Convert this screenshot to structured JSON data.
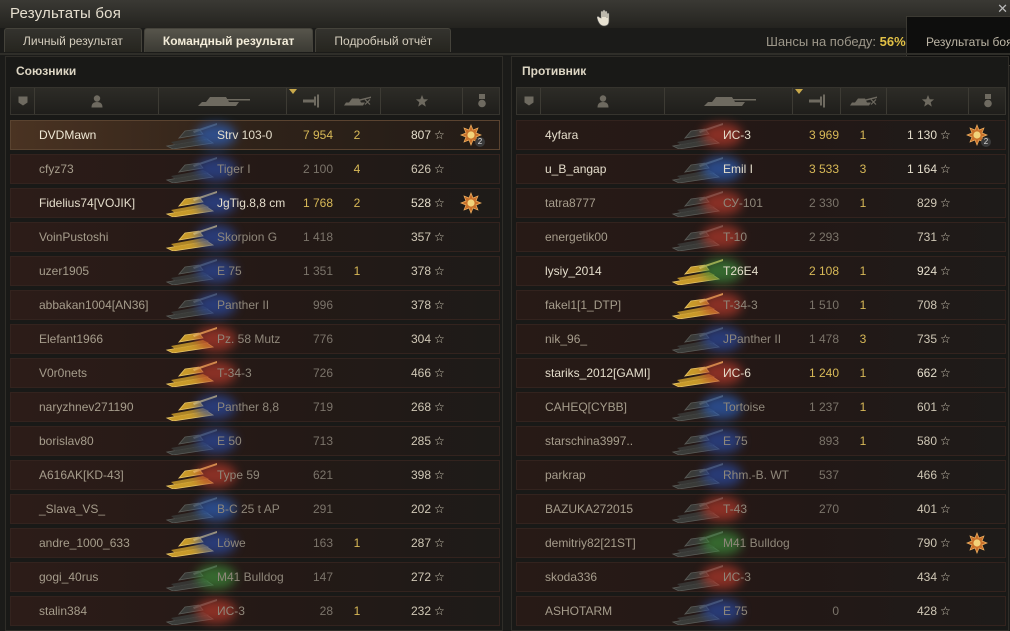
{
  "window": {
    "title": "Результаты боя"
  },
  "tabs": [
    {
      "label": "Личный результат",
      "active": false
    },
    {
      "label": "Командный результат",
      "active": true
    },
    {
      "label": "Подробный отчёт",
      "active": false
    }
  ],
  "chances": {
    "label": "Шансы на победу:",
    "value": "56%"
  },
  "tooltip": {
    "text": "Результаты боя"
  },
  "colors": {
    "accent": "#d8b957",
    "highlight_name": "#f0e9d6",
    "background": "#1b1b19"
  },
  "allies": {
    "title": "Союзники",
    "players": [
      {
        "name": "DVDMawn",
        "tank": "Strv 103-0",
        "tank_tone": "dark",
        "nation": "#2d5fb8",
        "damage": "7 954",
        "kills": "2",
        "xp": "807",
        "bright": true,
        "me": true,
        "medal": {
          "kind": "orange",
          "count": "2"
        }
      },
      {
        "name": "cfyz73",
        "tank": "Tiger I",
        "tank_tone": "dark",
        "nation": "#2b4aa0",
        "damage": "2 100",
        "kills": "4",
        "xp": "626",
        "bright": false,
        "me": false,
        "medal": null
      },
      {
        "name": "Fidelius74[VOJIK]",
        "tank": "JgTig.8,8 cm",
        "tank_tone": "gold",
        "nation": "#2b4aa0",
        "damage": "1 768",
        "kills": "2",
        "xp": "528",
        "bright": true,
        "me": false,
        "medal": {
          "kind": "orange",
          "count": ""
        }
      },
      {
        "name": "VoinPustoshi",
        "tank": "Skorpion G",
        "tank_tone": "gold",
        "nation": "#2b4aa0",
        "damage": "1 418",
        "kills": "",
        "xp": "357",
        "bright": false,
        "me": false,
        "medal": null
      },
      {
        "name": "uzer1905",
        "tank": "E 75",
        "tank_tone": "dark",
        "nation": "#2b4aa0",
        "damage": "1 351",
        "kills": "1",
        "xp": "378",
        "bright": false,
        "me": false,
        "medal": null
      },
      {
        "name": "abbakan1004[AN36]",
        "tank": "Panther II",
        "tank_tone": "dark",
        "nation": "#2b4aa0",
        "damage": "996",
        "kills": "",
        "xp": "378",
        "bright": false,
        "me": false,
        "medal": null
      },
      {
        "name": "Elefant1966",
        "tank": "Pz. 58 Mutz",
        "tank_tone": "gold",
        "nation": "#b43a2c",
        "damage": "776",
        "kills": "",
        "xp": "304",
        "bright": false,
        "me": false,
        "medal": null
      },
      {
        "name": "V0r0nets",
        "tank": "T-34-3",
        "tank_tone": "gold",
        "nation": "#b43a2c",
        "damage": "726",
        "kills": "",
        "xp": "466",
        "bright": false,
        "me": false,
        "medal": null
      },
      {
        "name": "naryzhnev271190",
        "tank": "Panther 8,8",
        "tank_tone": "gold",
        "nation": "#2b4aa0",
        "damage": "719",
        "kills": "",
        "xp": "268",
        "bright": false,
        "me": false,
        "medal": null
      },
      {
        "name": "borislav80",
        "tank": "E 50",
        "tank_tone": "dark",
        "nation": "#2b4aa0",
        "damage": "713",
        "kills": "",
        "xp": "285",
        "bright": false,
        "me": false,
        "medal": null
      },
      {
        "name": "A616AK[KD-43]",
        "tank": "Type 59",
        "tank_tone": "gold",
        "nation": "#b43a2c",
        "damage": "621",
        "kills": "",
        "xp": "398",
        "bright": false,
        "me": false,
        "medal": null
      },
      {
        "name": "_Slava_VS_",
        "tank": "B-C 25 t AP",
        "tank_tone": "dark",
        "nation": "#2d5fb8",
        "damage": "291",
        "kills": "",
        "xp": "202",
        "bright": false,
        "me": false,
        "medal": null
      },
      {
        "name": "andre_1000_633",
        "tank": "Löwe",
        "tank_tone": "gold",
        "nation": "#2b4aa0",
        "damage": "163",
        "kills": "1",
        "xp": "287",
        "bright": false,
        "me": false,
        "medal": null
      },
      {
        "name": "gogi_40rus",
        "tank": "M41 Bulldog",
        "tank_tone": "dark",
        "nation": "#3d8a3a",
        "damage": "147",
        "kills": "",
        "xp": "272",
        "bright": false,
        "me": false,
        "medal": null
      },
      {
        "name": "stalin384",
        "tank": "ИС-3",
        "tank_tone": "dark",
        "nation": "#b43a2c",
        "damage": "28",
        "kills": "1",
        "xp": "232",
        "bright": false,
        "me": false,
        "medal": null
      }
    ]
  },
  "enemies": {
    "title": "Противник",
    "players": [
      {
        "name": "4yfara",
        "tank": "ИС-3",
        "tank_tone": "dark",
        "nation": "#b43a2c",
        "damage": "3 969",
        "kills": "1",
        "xp": "1 130",
        "bright": true,
        "me": false,
        "medal": {
          "kind": "orange",
          "count": "2"
        }
      },
      {
        "name": "u_B_angap",
        "tank": "Emil I",
        "tank_tone": "dark",
        "nation": "#2d5fb8",
        "damage": "3 533",
        "kills": "3",
        "xp": "1 164",
        "bright": true,
        "me": false,
        "medal": null
      },
      {
        "name": "tatra8777",
        "tank": "СУ-101",
        "tank_tone": "dark",
        "nation": "#b43a2c",
        "damage": "2 330",
        "kills": "1",
        "xp": "829",
        "bright": false,
        "me": false,
        "medal": null
      },
      {
        "name": "energetik00",
        "tank": "T-10",
        "tank_tone": "dark",
        "nation": "#b43a2c",
        "damage": "2 293",
        "kills": "",
        "xp": "731",
        "bright": false,
        "me": false,
        "medal": null
      },
      {
        "name": "lysiy_2014",
        "tank": "T26E4",
        "tank_tone": "gold",
        "nation": "#3d8a3a",
        "damage": "2 108",
        "kills": "1",
        "xp": "924",
        "bright": true,
        "me": false,
        "medal": null
      },
      {
        "name": "fakel1[1_DTP]",
        "tank": "T-34-3",
        "tank_tone": "gold",
        "nation": "#b43a2c",
        "damage": "1 510",
        "kills": "1",
        "xp": "708",
        "bright": false,
        "me": false,
        "medal": null
      },
      {
        "name": "nik_96_",
        "tank": "JPanther II",
        "tank_tone": "dark",
        "nation": "#2b4aa0",
        "damage": "1 478",
        "kills": "3",
        "xp": "735",
        "bright": false,
        "me": false,
        "medal": null
      },
      {
        "name": "stariks_2012[GAMI]",
        "tank": "ИС-6",
        "tank_tone": "gold",
        "nation": "#b43a2c",
        "damage": "1 240",
        "kills": "1",
        "xp": "662",
        "bright": true,
        "me": false,
        "medal": null
      },
      {
        "name": "CAHEQ[CYBB]",
        "tank": "Tortoise",
        "tank_tone": "dark",
        "nation": "#2d5fb8",
        "damage": "1 237",
        "kills": "1",
        "xp": "601",
        "bright": false,
        "me": false,
        "medal": null
      },
      {
        "name": "starschina3997..",
        "tank": "E 75",
        "tank_tone": "dark",
        "nation": "#2b4aa0",
        "damage": "893",
        "kills": "1",
        "xp": "580",
        "bright": false,
        "me": false,
        "medal": null
      },
      {
        "name": "parkrap",
        "tank": "Rhm.-B. WT",
        "tank_tone": "dark",
        "nation": "#2b4aa0",
        "damage": "537",
        "kills": "",
        "xp": "466",
        "bright": false,
        "me": false,
        "medal": null
      },
      {
        "name": "BAZUKA272015",
        "tank": "T-43",
        "tank_tone": "dark",
        "nation": "#b43a2c",
        "damage": "270",
        "kills": "",
        "xp": "401",
        "bright": false,
        "me": false,
        "medal": null
      },
      {
        "name": "demitriy82[21ST]",
        "tank": "M41 Bulldog",
        "tank_tone": "dark",
        "nation": "#3d8a3a",
        "damage": "",
        "kills": "",
        "xp": "790",
        "bright": false,
        "me": false,
        "medal": {
          "kind": "orange",
          "count": ""
        }
      },
      {
        "name": "skoda336",
        "tank": "ИС-3",
        "tank_tone": "dark",
        "nation": "#b43a2c",
        "damage": "",
        "kills": "",
        "xp": "434",
        "bright": false,
        "me": false,
        "medal": null
      },
      {
        "name": "ASHOTARM",
        "tank": "E 75",
        "tank_tone": "dark",
        "nation": "#2b4aa0",
        "damage": "0",
        "kills": "",
        "xp": "428",
        "bright": false,
        "me": false,
        "medal": null
      }
    ]
  }
}
